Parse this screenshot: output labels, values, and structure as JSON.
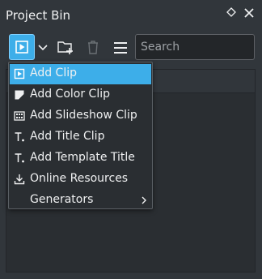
{
  "window": {
    "title": "Project Bin"
  },
  "toolbar": {
    "search_placeholder": "Search"
  },
  "header": {
    "column_label": ""
  },
  "menu": {
    "items": [
      {
        "label": "Add Clip",
        "icon": "add-clip-icon",
        "selected": true
      },
      {
        "label": "Add Color Clip",
        "icon": "color-clip-icon"
      },
      {
        "label": "Add Slideshow Clip",
        "icon": "slideshow-icon"
      },
      {
        "label": "Add Title Clip",
        "icon": "title-clip-icon"
      },
      {
        "label": "Add Template Title",
        "icon": "template-title-icon"
      },
      {
        "label": "Online Resources",
        "icon": "download-icon"
      },
      {
        "label": "Generators",
        "icon": "",
        "submenu": true
      }
    ]
  },
  "colors": {
    "accent": "#3daee9",
    "background": "#31363b",
    "text": "#eff0f1"
  }
}
